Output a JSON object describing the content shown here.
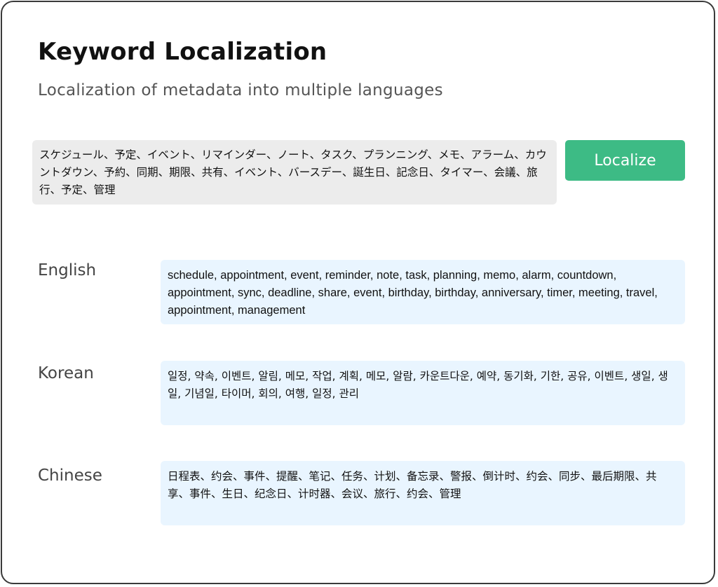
{
  "header": {
    "title": "Keyword Localization",
    "subtitle": "Localization of metadata into multiple languages"
  },
  "source": {
    "text": "スケジュール、予定、イベント、リマインダー、ノート、タスク、プランニング、メモ、アラーム、カウントダウン、予約、同期、期限、共有、イベント、バースデー、誕生日、記念日、タイマー、会議、旅行、予定、管理"
  },
  "actions": {
    "localize_label": "Localize"
  },
  "results": [
    {
      "language": "English",
      "text": "schedule, appointment, event, reminder, note, task, planning, memo, alarm, countdown, appointment, sync, deadline, share, event, birthday, birthday, anniversary, timer, meeting, travel, appointment, management"
    },
    {
      "language": "Korean",
      "text": "일정, 약속, 이벤트, 알림, 메모, 작업, 계획, 메모, 알람, 카운트다운, 예약, 동기화, 기한, 공유, 이벤트, 생일, 생일, 기념일, 타이머, 회의, 여행, 일정, 관리"
    },
    {
      "language": "Chinese",
      "text": "日程表、约会、事件、提醒、笔记、任务、计划、备忘录、警报、倒计时、约会、同步、最后期限、共享、事件、生日、纪念日、计时器、会议、旅行、约会、管理"
    }
  ],
  "colors": {
    "accent": "#3dbb85",
    "source_bg": "#ececec",
    "result_bg": "#e9f5ff"
  }
}
